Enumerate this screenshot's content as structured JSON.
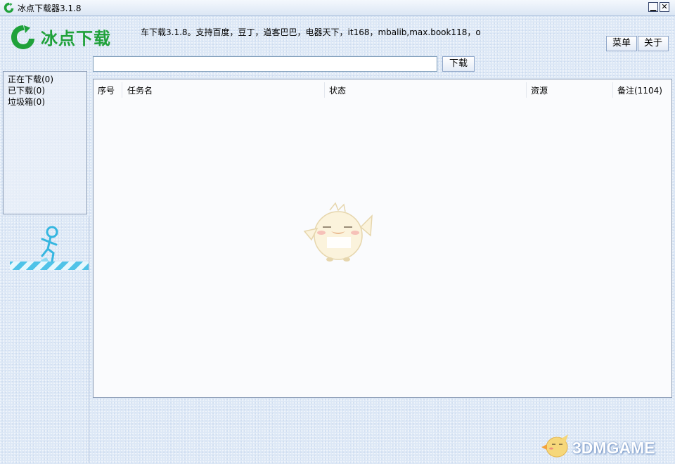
{
  "window": {
    "title": "冰点下载器3.1.8",
    "minimize_glyph": "▁",
    "close_glyph": "✕"
  },
  "header": {
    "logo_text": "冰点下载",
    "notice": "车下载3.1.8。支持百度，豆丁，道客巴巴，电器天下，it168，mbalib,max.book118，o",
    "menu_label": "菜单",
    "about_label": "关于"
  },
  "url_bar": {
    "value": "",
    "placeholder": "",
    "download_label": "下载"
  },
  "sidebar": {
    "items": [
      {
        "label": "正在下载(0)"
      },
      {
        "label": "已下载(0)"
      },
      {
        "label": "垃圾箱(0)"
      }
    ]
  },
  "table": {
    "columns": [
      {
        "label": "序号"
      },
      {
        "label": "任务名"
      },
      {
        "label": "状态"
      },
      {
        "label": "资源"
      },
      {
        "label": "备注(1104)"
      }
    ],
    "rows": []
  },
  "watermark": {
    "text": "3DMGAME"
  },
  "colors": {
    "brand_green": "#1fa13a",
    "accent_cyan": "#4fc3e8",
    "background": "#dde8f6"
  },
  "icons": {
    "app": "green-circle-logo-icon",
    "window_minimize": "minimize-icon",
    "window_close": "close-icon"
  }
}
